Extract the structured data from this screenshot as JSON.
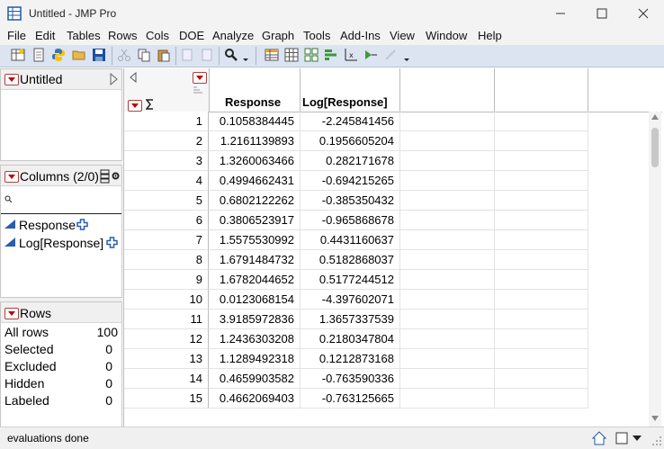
{
  "window": {
    "title": "Untitled - JMP Pro"
  },
  "menu": [
    "File",
    "Edit",
    "Tables",
    "Rows",
    "Cols",
    "DOE",
    "Analyze",
    "Graph",
    "Tools",
    "Add-Ins",
    "View",
    "Window",
    "Help"
  ],
  "table_panel": {
    "title": "Untitled"
  },
  "columns_panel": {
    "title": "Columns (2/0)",
    "items": [
      "Response",
      "Log[Response]"
    ]
  },
  "rows_panel": {
    "title": "Rows",
    "stats": [
      {
        "label": "All rows",
        "value": "100"
      },
      {
        "label": "Selected",
        "value": "0"
      },
      {
        "label": "Excluded",
        "value": "0"
      },
      {
        "label": "Hidden",
        "value": "0"
      },
      {
        "label": "Labeled",
        "value": "0"
      }
    ]
  },
  "grid": {
    "columns": [
      "Response",
      "Log[Response]"
    ],
    "rows": [
      [
        "1",
        "0.1058384445",
        "-2.245841456"
      ],
      [
        "2",
        "1.2161139893",
        "0.1956605204"
      ],
      [
        "3",
        "1.3260063466",
        "0.282171678"
      ],
      [
        "4",
        "0.4994662431",
        "-0.694215265"
      ],
      [
        "5",
        "0.6802122262",
        "-0.385350432"
      ],
      [
        "6",
        "0.3806523917",
        "-0.965868678"
      ],
      [
        "7",
        "1.5575530992",
        "0.4431160637"
      ],
      [
        "8",
        "1.6791484732",
        "0.5182868037"
      ],
      [
        "9",
        "1.6782044652",
        "0.5177244512"
      ],
      [
        "10",
        "0.0123068154",
        "-4.397602071"
      ],
      [
        "11",
        "3.9185972836",
        "1.3657337539"
      ],
      [
        "12",
        "1.2436303208",
        "0.2180347804"
      ],
      [
        "13",
        "1.1289492318",
        "0.1212873168"
      ],
      [
        "14",
        "0.4659903582",
        "-0.763590336"
      ],
      [
        "15",
        "0.4662069403",
        "-0.763125665"
      ]
    ]
  },
  "status": {
    "text": "evaluations done"
  },
  "colors": {
    "accent_red": "#c00000",
    "toolbar_bg": "#dbe4f0",
    "column_icon_blue": "#2a5db0"
  }
}
